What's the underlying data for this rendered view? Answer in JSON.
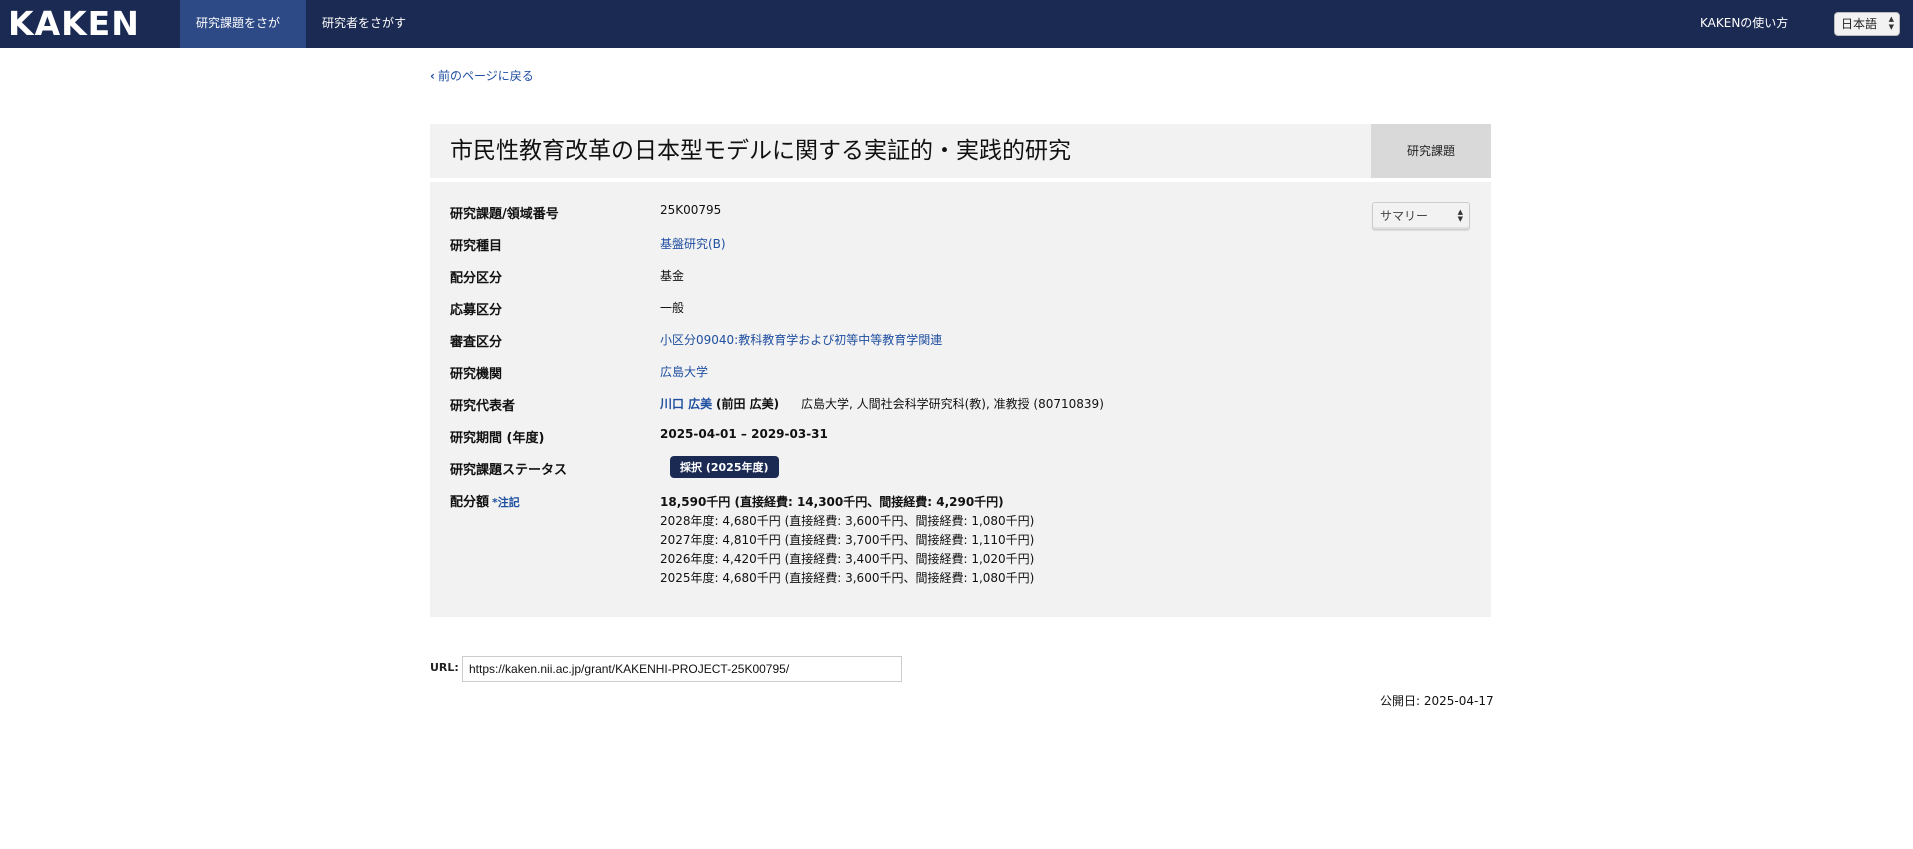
{
  "header": {
    "logo": "KAKEN",
    "tabs": [
      {
        "label": "研究課題をさがす",
        "active": true
      },
      {
        "label": "研究者をさがす",
        "active": false
      }
    ],
    "howto": "KAKENの使い方",
    "language": "日本語"
  },
  "back_link": "前のページに戻る",
  "project": {
    "title": "市民性教育改革の日本型モデルに関する実証的・実践的研究",
    "type_label": "研究課題",
    "view_select": "サマリー",
    "fields": {
      "number": {
        "label": "研究課題/領域番号",
        "value": "25K00795"
      },
      "category": {
        "label": "研究種目",
        "value": "基盤研究(B)"
      },
      "allocation": {
        "label": "配分区分",
        "value": "基金"
      },
      "application": {
        "label": "応募区分",
        "value": "一般"
      },
      "review": {
        "label": "審査区分",
        "value": "小区分09040:教科教育学および初等中等教育学関連"
      },
      "institution": {
        "label": "研究機関",
        "value": "広島大学"
      },
      "pi": {
        "label": "研究代表者",
        "name": "川口 広美",
        "former_name": "(前田 広美)",
        "affiliation": "広島大学, 人間社会科学研究科(教), 准教授 (80710839)"
      },
      "period": {
        "label": "研究期間 (年度)",
        "value": "2025-04-01 – 2029-03-31"
      },
      "status": {
        "label": "研究課題ステータス",
        "value": "採択 (2025年度)"
      },
      "budget": {
        "label": "配分額",
        "note": "*注記",
        "total": "18,590千円 (直接経費: 14,300千円、間接経費: 4,290千円)",
        "years": [
          "2028年度: 4,680千円 (直接経費: 3,600千円、間接経費: 1,080千円)",
          "2027年度: 4,810千円 (直接経費: 3,700千円、間接経費: 1,110千円)",
          "2026年度: 4,420千円 (直接経費: 3,400千円、間接経費: 1,020千円)",
          "2025年度: 4,680千円 (直接経費: 3,600千円、間接経費: 1,080千円)"
        ]
      }
    }
  },
  "url": {
    "label": "URL:",
    "value": "https://kaken.nii.ac.jp/grant/KAKENHI-PROJECT-25K00795/"
  },
  "published": "公開日: 2025-04-17"
}
